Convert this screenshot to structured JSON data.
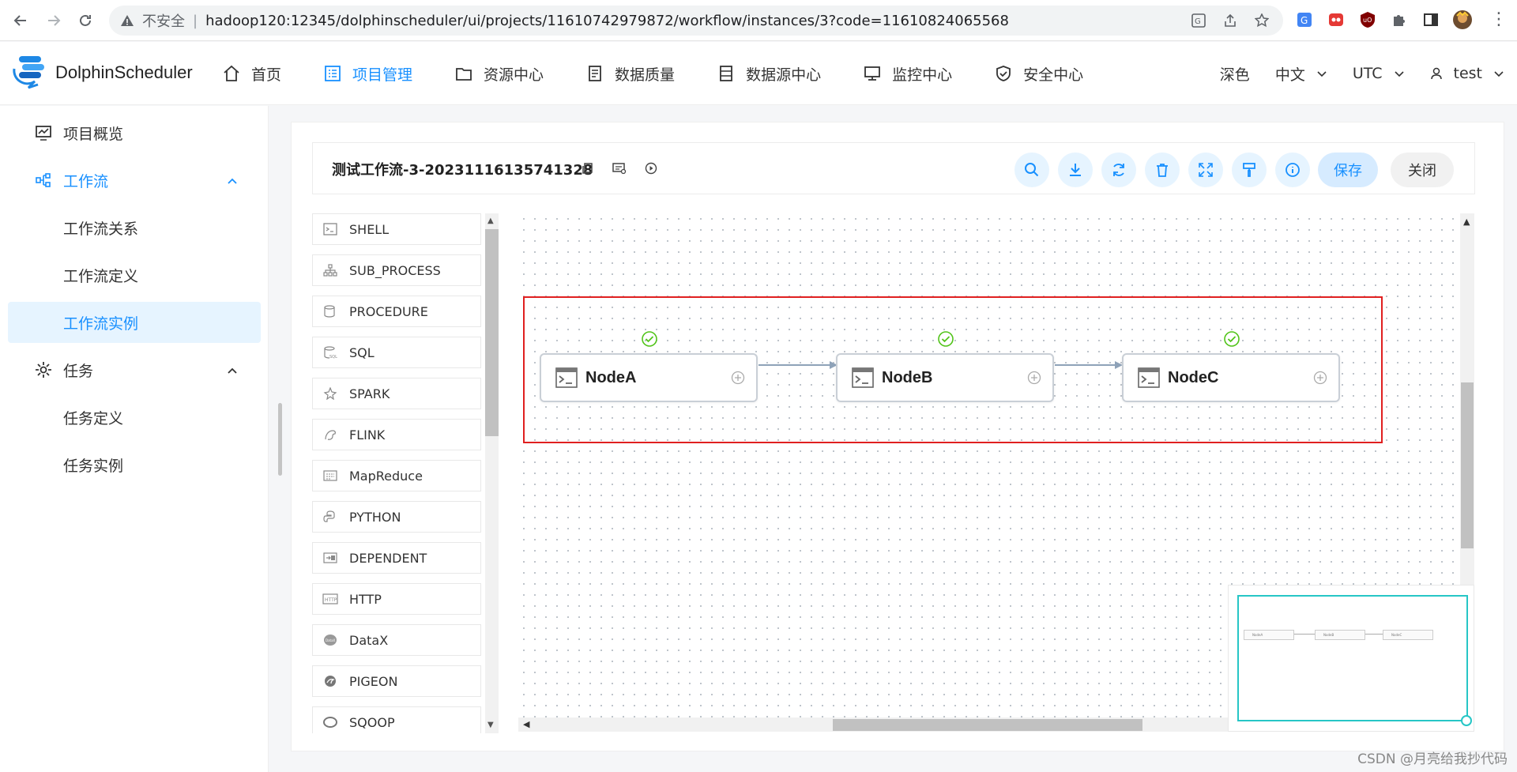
{
  "browser": {
    "insecure_label": "不安全",
    "url": "hadoop120:12345/dolphinscheduler/ui/projects/11610742979872/workflow/instances/3?code=11610824065568"
  },
  "app": {
    "name": "DolphinScheduler",
    "nav": [
      {
        "label": "首页",
        "icon": "home-icon"
      },
      {
        "label": "项目管理",
        "icon": "project-icon",
        "active": true
      },
      {
        "label": "资源中心",
        "icon": "folder-icon"
      },
      {
        "label": "数据质量",
        "icon": "quality-icon"
      },
      {
        "label": "数据源中心",
        "icon": "datasource-icon"
      },
      {
        "label": "监控中心",
        "icon": "monitor-icon"
      },
      {
        "label": "安全中心",
        "icon": "shield-icon"
      }
    ],
    "theme_label": "深色",
    "lang_label": "中文",
    "timezone_label": "UTC",
    "user_label": "test"
  },
  "sidebar": {
    "overview": "项目概览",
    "workflow": "工作流",
    "workflow_relation": "工作流关系",
    "workflow_definition": "工作流定义",
    "workflow_instance": "工作流实例",
    "task": "任务",
    "task_definition": "任务定义",
    "task_instance": "任务实例"
  },
  "toolbar": {
    "title": "测试工作流-3-20231116135741328",
    "save_label": "保存",
    "close_label": "关闭"
  },
  "palette": {
    "items": [
      "SHELL",
      "SUB_PROCESS",
      "PROCEDURE",
      "SQL",
      "SPARK",
      "FLINK",
      "MapReduce",
      "PYTHON",
      "DEPENDENT",
      "HTTP",
      "DataX",
      "PIGEON",
      "SQOOP"
    ]
  },
  "canvas": {
    "nodes": [
      {
        "label": "NodeA",
        "status": "success"
      },
      {
        "label": "NodeB",
        "status": "success"
      },
      {
        "label": "NodeC",
        "status": "success"
      }
    ],
    "minimap_nodes": [
      "NodeA",
      "NodeB",
      "NodeC"
    ]
  },
  "watermark": "CSDN @月亮给我抄代码",
  "colors": {
    "accent": "#1890ff",
    "highlight": "#e02020",
    "success": "#52c41a",
    "minimap": "#26c6c6"
  }
}
